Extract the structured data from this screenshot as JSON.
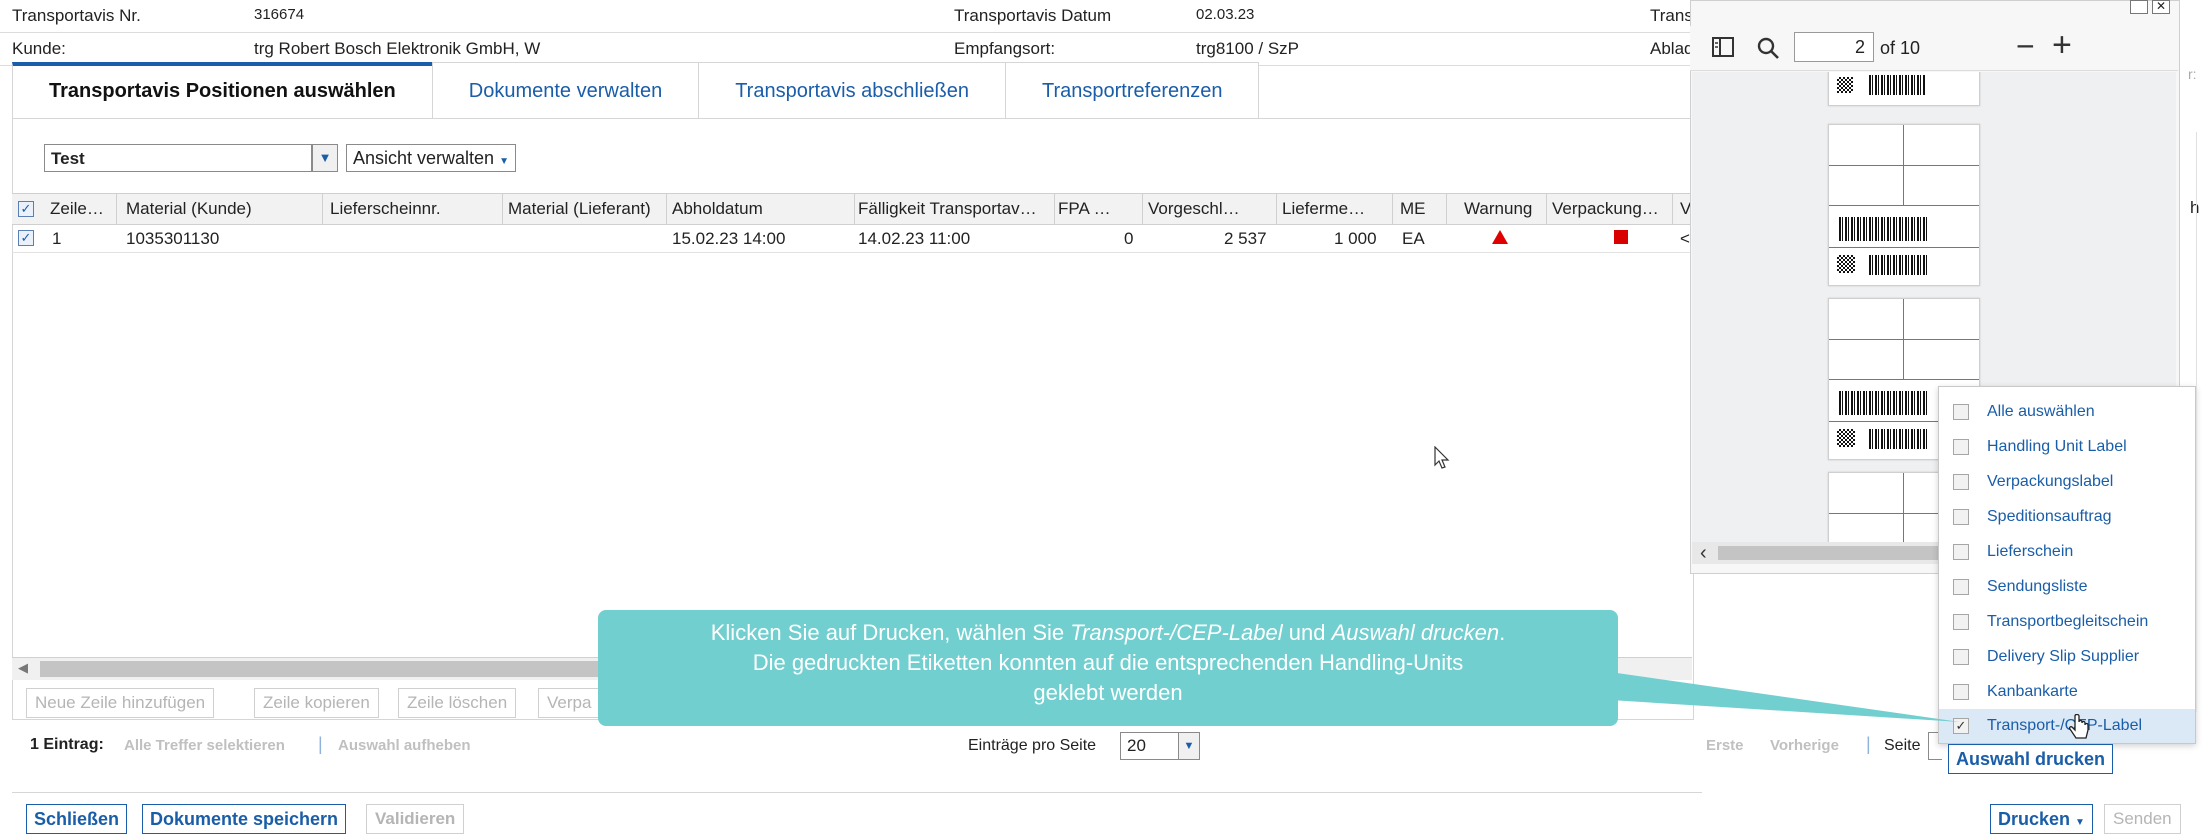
{
  "header": {
    "row1": {
      "transportavis_nr_label": "Transportavis Nr.",
      "transportavis_nr_value": "316674",
      "datum_label": "Transportavis Datum",
      "datum_value": "02.03.23",
      "trans_label": "Trans"
    },
    "row2": {
      "kunde_label": "Kunde:",
      "kunde_value": "trg Robert Bosch Elektronik GmbH, W",
      "empfangsort_label": "Empfangsort:",
      "empfangsort_value": "trg8100 / SzP",
      "ablad_label": "Ablad"
    }
  },
  "tabs": [
    {
      "label": "Transportavis Positionen auswählen",
      "active": true
    },
    {
      "label": "Dokumente verwalten",
      "active": false
    },
    {
      "label": "Transportavis abschließen",
      "active": false
    },
    {
      "label": "Transportreferenzen",
      "active": false
    }
  ],
  "toolbar": {
    "variant_value": "Test",
    "view_manage_label": "Ansicht verwalten"
  },
  "table": {
    "columns": [
      "Zeile…",
      "Material (Kunde)",
      "Lieferscheinnr.",
      "Material (Lieferant)",
      "Abholdatum",
      "Fälligkeit Transportav…",
      "FPA …",
      "Vorgeschl…",
      "Lieferme…",
      "ME",
      "Warnung",
      "Verpackung…",
      "V"
    ],
    "extra_col_right": "h",
    "rows": [
      {
        "zeile": "1",
        "material_kunde": "1035301130",
        "lieferscheinnr": "",
        "material_lieferant": "",
        "abholdatum": "15.02.23 14:00",
        "faelligkeit": "14.02.23 11:00",
        "fpa": "0",
        "vorgeschl": "2 537",
        "liefermenge": "1 000",
        "me": "EA",
        "v": "<"
      }
    ]
  },
  "row_actions": {
    "add": "Neue Zeile hinzufügen",
    "copy": "Zeile kopieren",
    "delete": "Zeile löschen",
    "verpa": "Verpa"
  },
  "pagination": {
    "count_label": "1 Eintrag:",
    "select_all": "Alle Treffer selektieren",
    "deselect": "Auswahl aufheben",
    "per_page_label": "Einträge pro Seite",
    "per_page_value": "20",
    "first": "Erste",
    "prev": "Vorherige",
    "page_label": "Seite"
  },
  "footer": {
    "close": "Schließen",
    "save_docs": "Dokumente speichern",
    "validate": "Validieren",
    "print": "Drucken",
    "send": "Senden"
  },
  "pdf_viewer": {
    "page_value": "2",
    "page_total": "of 10"
  },
  "print_menu": {
    "items": [
      {
        "label": "Alle auswählen",
        "checked": false
      },
      {
        "label": "Handling Unit Label",
        "checked": false
      },
      {
        "label": "Verpackungslabel",
        "checked": false
      },
      {
        "label": "Speditionsauftrag",
        "checked": false
      },
      {
        "label": "Lieferschein",
        "checked": false
      },
      {
        "label": "Sendungsliste",
        "checked": false
      },
      {
        "label": "Transportbegleitschein",
        "checked": false
      },
      {
        "label": "Delivery Slip Supplier",
        "checked": false
      },
      {
        "label": "Kanbankarte",
        "checked": false
      },
      {
        "label": "Transport-/CEP-Label",
        "checked": true
      }
    ],
    "print_selection": "Auswahl drucken"
  },
  "callout": {
    "line1_a": "Klicken Sie auf Drucken, wählen Sie ",
    "line1_em1": "Transport-/CEP-Label",
    "line1_b": " und ",
    "line1_em2": "Auswahl drucken",
    "line1_c": ".",
    "line2": "Die gedruckten Etiketten konnten auf die entsprechenden Handling-Units",
    "line3": "geklebt werden"
  },
  "colors": {
    "link_blue": "#1a5da8",
    "callout_teal": "#72cfcf",
    "warning_red": "#e00000"
  }
}
